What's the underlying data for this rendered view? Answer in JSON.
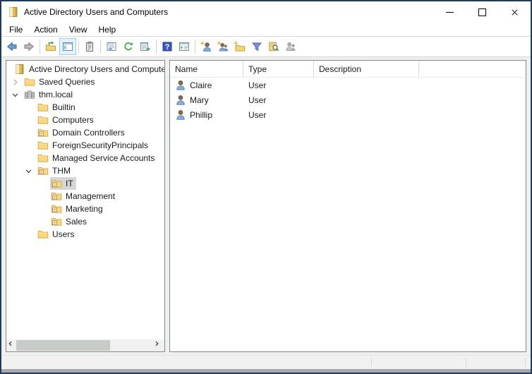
{
  "window": {
    "title": "Active Directory Users and Computers",
    "controls": {
      "minimize": "minimize",
      "maximize": "maximize",
      "close": "close"
    }
  },
  "menu": {
    "items": [
      "File",
      "Action",
      "View",
      "Help"
    ]
  },
  "toolbar": {
    "items": [
      "back",
      "forward",
      "|",
      "up-one-level",
      "console-tree-toggle",
      "|",
      "properties",
      "|",
      "dialog-window",
      "refresh",
      "export-list",
      "|",
      "help",
      "action-pane-toggle",
      "|",
      "new-user",
      "new-group",
      "new-ou",
      "filter",
      "find",
      "advanced-security"
    ],
    "selected_item": "console-tree-toggle"
  },
  "tree": {
    "items": [
      {
        "label": "Active Directory Users and Computers [",
        "depth": 0,
        "icon": "root-book",
        "expander": "none",
        "selected": false
      },
      {
        "label": "Saved Queries",
        "depth": 1,
        "icon": "folder",
        "expander": "collapsed",
        "selected": false
      },
      {
        "label": "thm.local",
        "depth": 1,
        "icon": "domain",
        "expander": "expanded",
        "selected": false
      },
      {
        "label": "Builtin",
        "depth": 2,
        "icon": "folder",
        "expander": "none",
        "selected": false
      },
      {
        "label": "Computers",
        "depth": 2,
        "icon": "folder",
        "expander": "none",
        "selected": false
      },
      {
        "label": "Domain Controllers",
        "depth": 2,
        "icon": "ou",
        "expander": "none",
        "selected": false
      },
      {
        "label": "ForeignSecurityPrincipals",
        "depth": 2,
        "icon": "folder",
        "expander": "none",
        "selected": false
      },
      {
        "label": "Managed Service Accounts",
        "depth": 2,
        "icon": "folder",
        "expander": "none",
        "selected": false
      },
      {
        "label": "THM",
        "depth": 2,
        "icon": "ou",
        "expander": "expanded",
        "selected": false
      },
      {
        "label": "IT",
        "depth": 3,
        "icon": "ou",
        "expander": "none",
        "selected": true
      },
      {
        "label": "Management",
        "depth": 3,
        "icon": "ou",
        "expander": "none",
        "selected": false
      },
      {
        "label": "Marketing",
        "depth": 3,
        "icon": "ou",
        "expander": "none",
        "selected": false
      },
      {
        "label": "Sales",
        "depth": 3,
        "icon": "ou",
        "expander": "none",
        "selected": false
      },
      {
        "label": "Users",
        "depth": 2,
        "icon": "folder",
        "expander": "none",
        "selected": false
      }
    ]
  },
  "list": {
    "columns": [
      "Name",
      "Type",
      "Description"
    ],
    "rows": [
      {
        "name": "Claire",
        "type": "User",
        "description": ""
      },
      {
        "name": "Mary",
        "type": "User",
        "description": ""
      },
      {
        "name": "Phillip",
        "type": "User",
        "description": ""
      }
    ]
  },
  "statusbar": {
    "cells": [
      "",
      "",
      ""
    ]
  },
  "colors": {
    "window_border": "#1e3c5f",
    "selection_inactive": "#d6d6d6",
    "toolbar_selected_bg": "#e4f1fb",
    "toolbar_selected_border": "#98d1ef",
    "folder_yellow": "#fbd978",
    "user_body_blue": "#85b2e0",
    "panel_border": "#828790"
  }
}
